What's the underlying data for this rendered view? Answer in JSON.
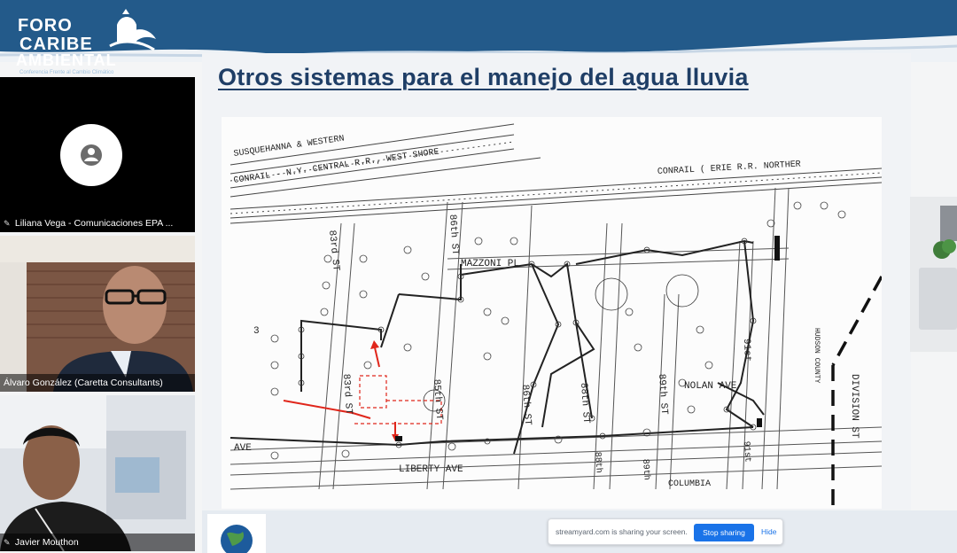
{
  "brand": {
    "line1": "FORO",
    "line2": "CARIBE",
    "line3": "AMBIENTAL",
    "tagline": "Conferencia Frente al Cambio Climático"
  },
  "participants": [
    {
      "name": "Liliana Vega - Comunicaciones EPA ...",
      "video": "off"
    },
    {
      "name": "Álvaro González (Caretta Consultants)",
      "video": "on"
    },
    {
      "name": "Javier Mouthon",
      "video": "on"
    }
  ],
  "slide": {
    "title": "Otros sistemas para el manejo del agua  lluvia",
    "map_labels": {
      "rail1": "SUSQUEHANNA & WESTERN",
      "rail2": "CONRAIL - N.Y. CENTRAL R.R., WEST SHORE",
      "rail3": "CONRAIL ( ERIE R.R. NORTHER",
      "st83": "83rd ST",
      "st86": "86th ST",
      "mazzoni": "MAZZONI PL",
      "st83b": "83rd ST",
      "st85": "85th ST",
      "st88": "88th ST",
      "st89": "89th ST",
      "nolan": "NOLAN AVE",
      "st91": "91st",
      "hudson": "HUDSON COUNTY",
      "division": "DIVISION ST",
      "ave": "AVE",
      "liberty": "LIBERTY AVE",
      "st88b": "88th",
      "st89b": "89th",
      "columbia": "COLUMBIA",
      "num3": "3",
      "st86b": "86th ST",
      "st91b": "91st"
    }
  },
  "screen_share": {
    "message": "streamyard.com is sharing your screen.",
    "stop_label": "Stop sharing",
    "hide_label": "Hide"
  },
  "colors": {
    "banner": "#235a8a",
    "title": "#1f3e66",
    "stop_button": "#1a73e8",
    "markup_red": "#e0261b"
  }
}
